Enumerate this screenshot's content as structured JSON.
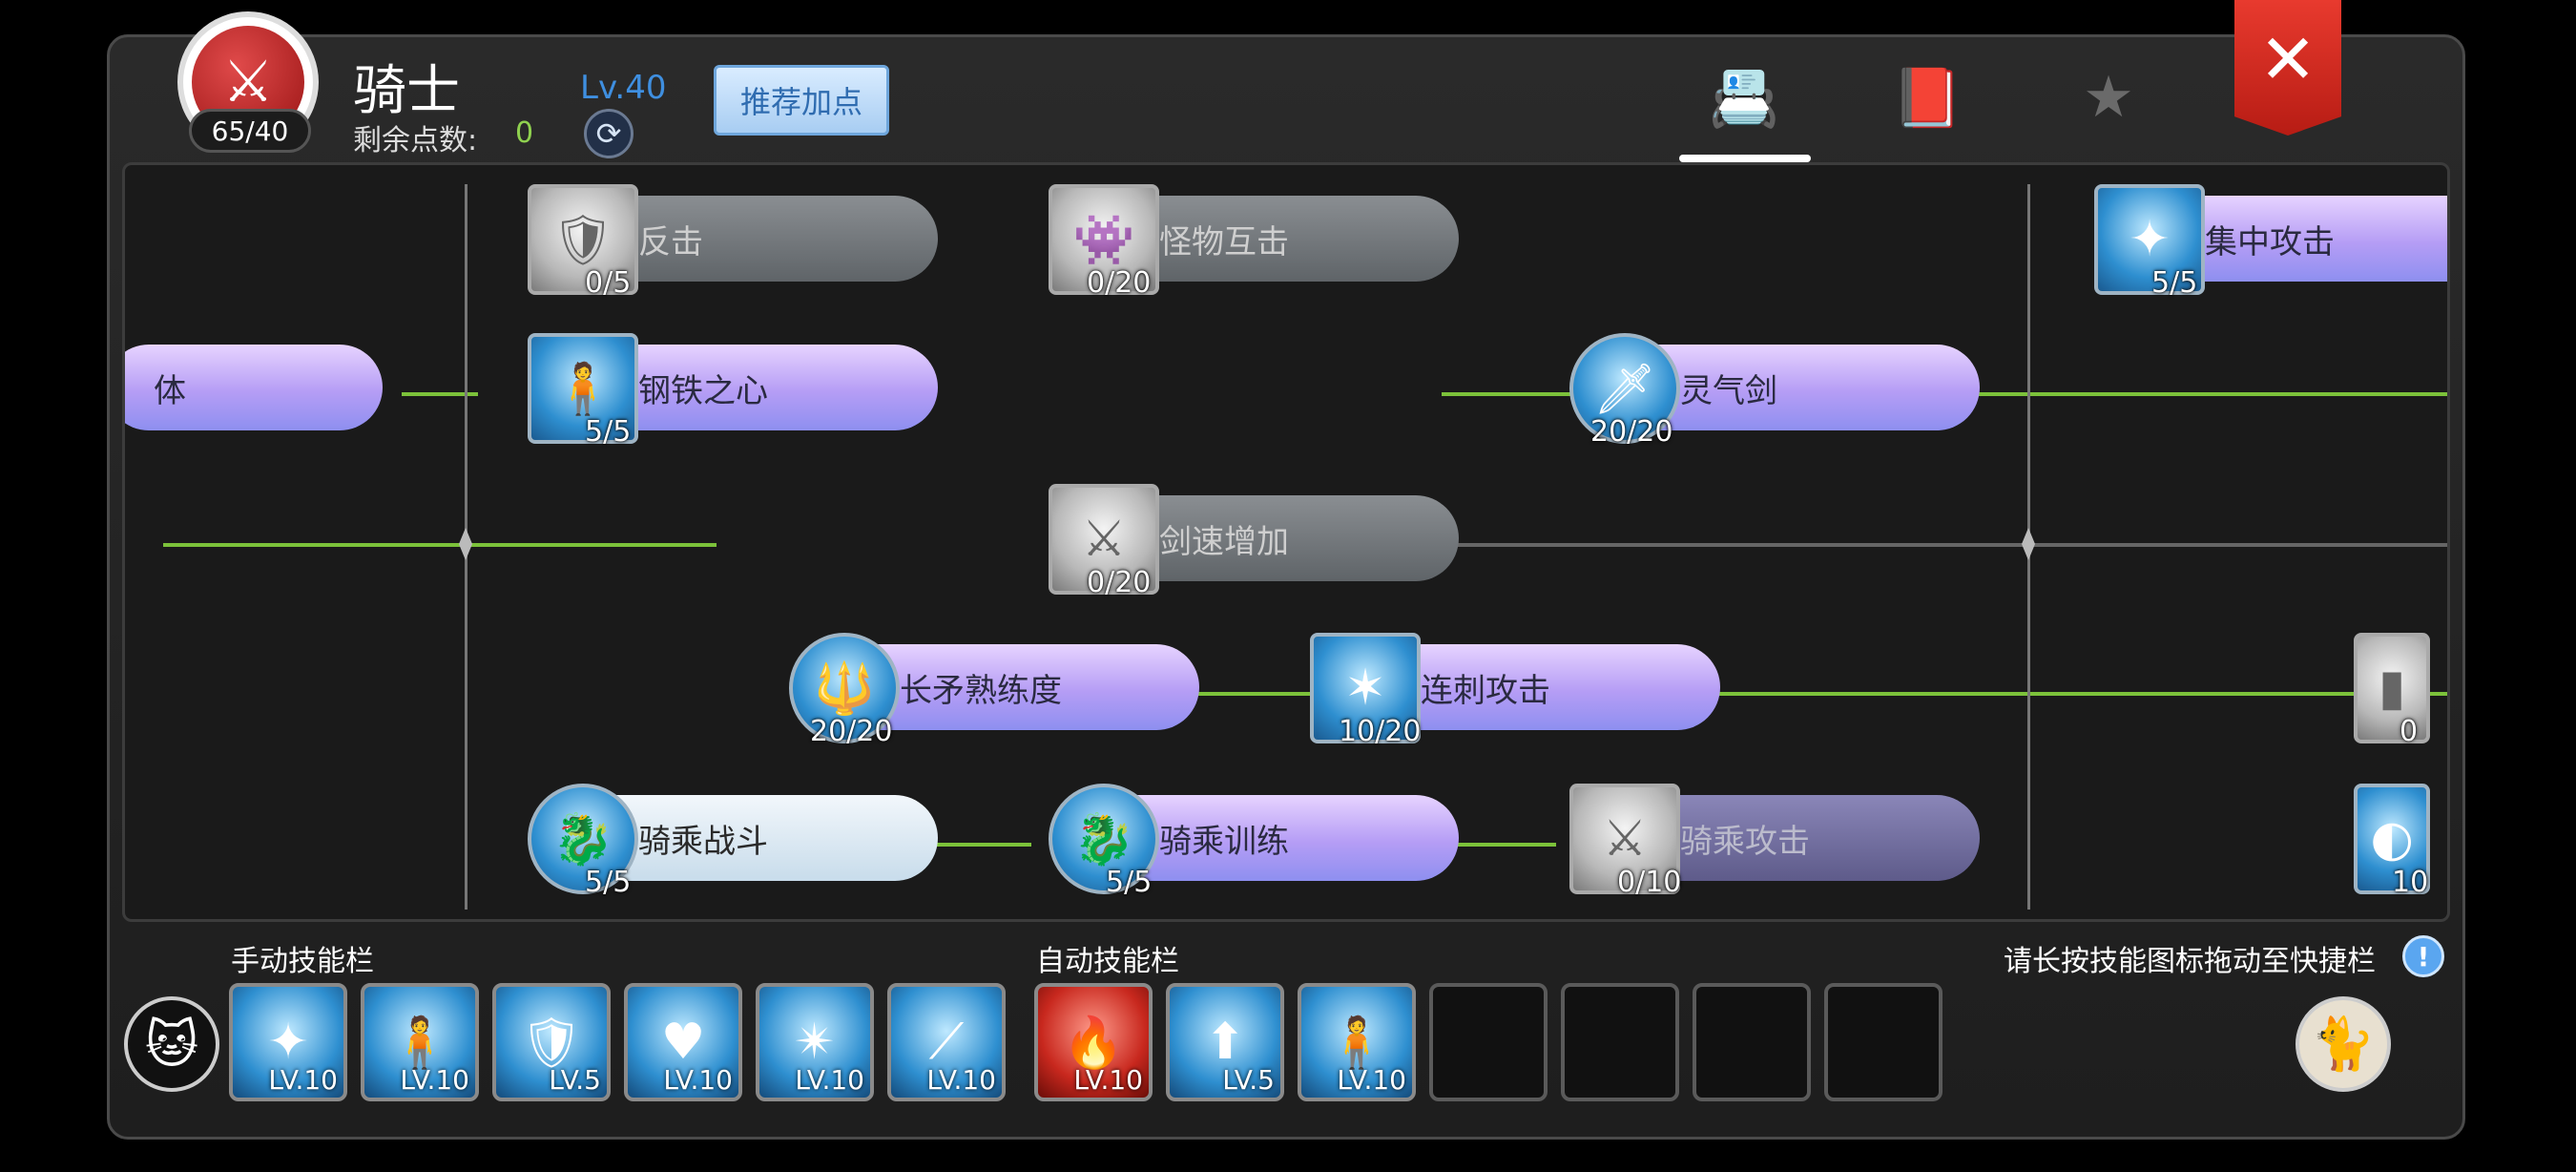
{
  "header": {
    "class_name": "骑士",
    "points_used": "65/40",
    "level": "Lv.40",
    "remaining_label": "剩余点数:",
    "remaining_value": "0",
    "recommend_label": "推荐加点",
    "close_label": "✕"
  },
  "colors": {
    "accent_green": "#7cc23a",
    "skill_purple": "#b59df5",
    "close_red": "#d42a20",
    "level_blue": "#3f8fe0"
  },
  "skills": [
    {
      "name": "反击",
      "count": "0/5"
    },
    {
      "name": "怪物互击",
      "count": "0/20"
    },
    {
      "name": "集中攻击",
      "count": "5/5"
    },
    {
      "name": "体",
      "count": ""
    },
    {
      "name": "钢铁之心",
      "count": "5/5"
    },
    {
      "name": "灵气剑",
      "count": "20/20"
    },
    {
      "name": "剑速增加",
      "count": "0/20"
    },
    {
      "name": "长矛熟练度",
      "count": "20/20"
    },
    {
      "name": "连刺攻击",
      "count": "10/20"
    },
    {
      "name": "",
      "count": "0"
    },
    {
      "name": "骑乘战斗",
      "count": "5/5"
    },
    {
      "name": "骑乘训练",
      "count": "5/5"
    },
    {
      "name": "骑乘攻击",
      "count": "0/10"
    },
    {
      "name": "",
      "count": "10"
    }
  ],
  "bottom": {
    "manual_label": "手动技能栏",
    "auto_label": "自动技能栏",
    "hint": "请长按技能图标拖动至快捷栏",
    "hint_icon": "!",
    "manual_slots": [
      "LV.10",
      "LV.10",
      "LV.5",
      "LV.10",
      "LV.10",
      "LV.10"
    ],
    "auto_slots": [
      "LV.10",
      "LV.5",
      "LV.10",
      "",
      "",
      "",
      ""
    ]
  }
}
